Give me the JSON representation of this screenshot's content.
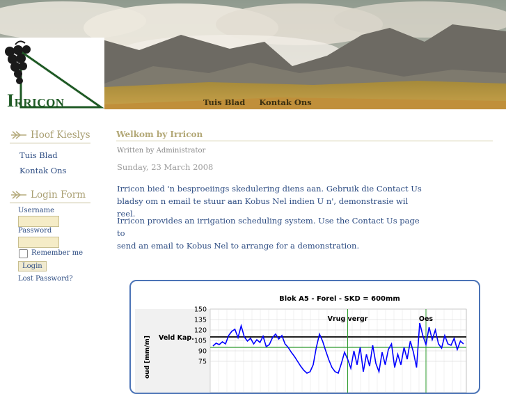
{
  "logo": {
    "first_letter": "I",
    "rest": "RRICON"
  },
  "topnav": {
    "items": [
      "Tuis Blad",
      "Kontak Ons"
    ]
  },
  "sidebar": {
    "main_menu_title": "Hoof Kieslys",
    "main_menu_items": [
      "Tuis Blad",
      "Kontak Ons"
    ],
    "login_title": "Login Form",
    "username_label": "Username",
    "password_label": "Password",
    "remember_label": "Remember me",
    "login_button": "Login",
    "lost_password": "Lost Password?"
  },
  "article": {
    "title": "Welkom by Irricon",
    "author": "Written by Administrator",
    "date": "Sunday, 23 March 2008",
    "para1_line1": "Irricon bied 'n besproeiings skedulering diens aan. Gebruik die Contact Us",
    "para1_line2": "bladsy om n email te stuur aan Kobus Nel indien U n', demonstrasie wil reel.",
    "para2_line1": "Irricon provides an irrigation scheduling system. Use the Contact Us page to",
    "para2_line2": "send an email to Kobus Nel to arrange for a demonstration."
  },
  "colors": {
    "accent": "#b3a877",
    "link": "#2e4d83",
    "logo_green": "#1f5a25",
    "chart_border": "#4b73b6",
    "series": "#0000ff",
    "field_capacity_line": "#000000",
    "refill_line": "#2e9b2e"
  },
  "chart_data": {
    "type": "line",
    "title": "Blok A5 - Forel - SKD = 600mm",
    "ylabel": "oud [mm/m]",
    "y_ticks": [
      150,
      135,
      120,
      105,
      90,
      75
    ],
    "ylim": [
      60,
      150
    ],
    "annotations": [
      {
        "text": "Veld Kap.",
        "y": 110
      },
      {
        "text": "Vrug vergr",
        "x": 43
      },
      {
        "text": "Oes",
        "x": 68
      }
    ],
    "reference_lines": [
      {
        "name": "Veld Kap.",
        "y": 110
      },
      {
        "name": "refill",
        "y": 95
      }
    ],
    "series": [
      {
        "values": [
          97,
          101,
          99,
          103,
          100,
          112,
          118,
          121,
          109,
          126,
          110,
          104,
          108,
          100,
          106,
          102,
          111,
          96,
          99,
          109,
          114,
          107,
          112,
          100,
          95,
          88,
          82,
          75,
          68,
          62,
          58,
          60,
          70,
          95,
          114,
          104,
          90,
          77,
          66,
          60,
          58,
          72,
          88,
          78,
          65,
          90,
          70,
          95,
          60,
          85,
          68,
          98,
          72,
          60,
          88,
          70,
          92,
          100,
          66,
          85,
          70,
          95,
          78,
          104,
          88,
          66,
          130,
          112,
          99,
          124,
          106,
          120,
          100,
          94,
          112,
          100,
          98,
          108,
          92,
          104,
          100
        ]
      }
    ]
  }
}
